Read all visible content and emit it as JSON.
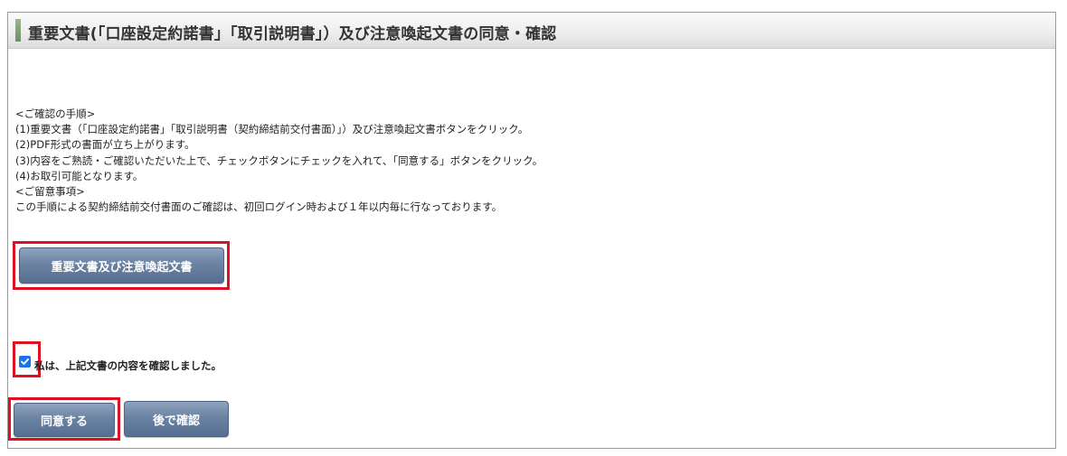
{
  "header": {
    "title": "重要文書(「口座設定約諾書」「取引説明書」）及び注意喚起文書の同意・確認"
  },
  "instructions": {
    "lines": [
      "<ご確認の手順>",
      "(1)重要文書（「口座設定約諾書」「取引説明書（契約締結前交付書面）」）及び注意喚起文書ボタンをクリック。",
      "(2)PDF形式の書面が立ち上がります。",
      "(3)内容をご熟読・ご確認いただいた上で、チェックボタンにチェックを入れて、「同意する」ボタンをクリック。",
      "(4)お取引可能となります。",
      "<ご留意事項>",
      "この手順による契約締結前交付書面のご確認は、初回ログイン時および１年以内毎に行なっております。"
    ]
  },
  "documents_button": {
    "label": "重要文書及び注意喚起文書"
  },
  "confirmation": {
    "checked": true,
    "label": "私は、上記文書の内容を確認しました。"
  },
  "actions": {
    "agree_label": "同意する",
    "later_label": "後で確認"
  },
  "colors": {
    "highlight_frame": "#dd1122",
    "button_blue": "#6b83a2",
    "checkbox_blue": "#1a73e8",
    "header_accent": "#7d9e6e"
  }
}
